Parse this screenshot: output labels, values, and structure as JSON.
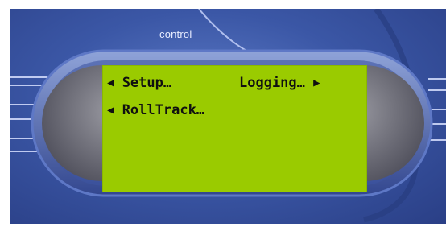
{
  "device": {
    "brand_label": "control"
  },
  "lcd": {
    "menu": [
      {
        "left_arrow": "◀",
        "label": "Setup…"
      },
      {
        "label": "Logging…",
        "right_arrow": "▶"
      },
      {
        "left_arrow": "◀",
        "label": "RollTrack…"
      }
    ]
  },
  "colors": {
    "lcd_background": "#9acb00",
    "lcd_text": "#101010",
    "panel_blue": "#3b57a6"
  }
}
